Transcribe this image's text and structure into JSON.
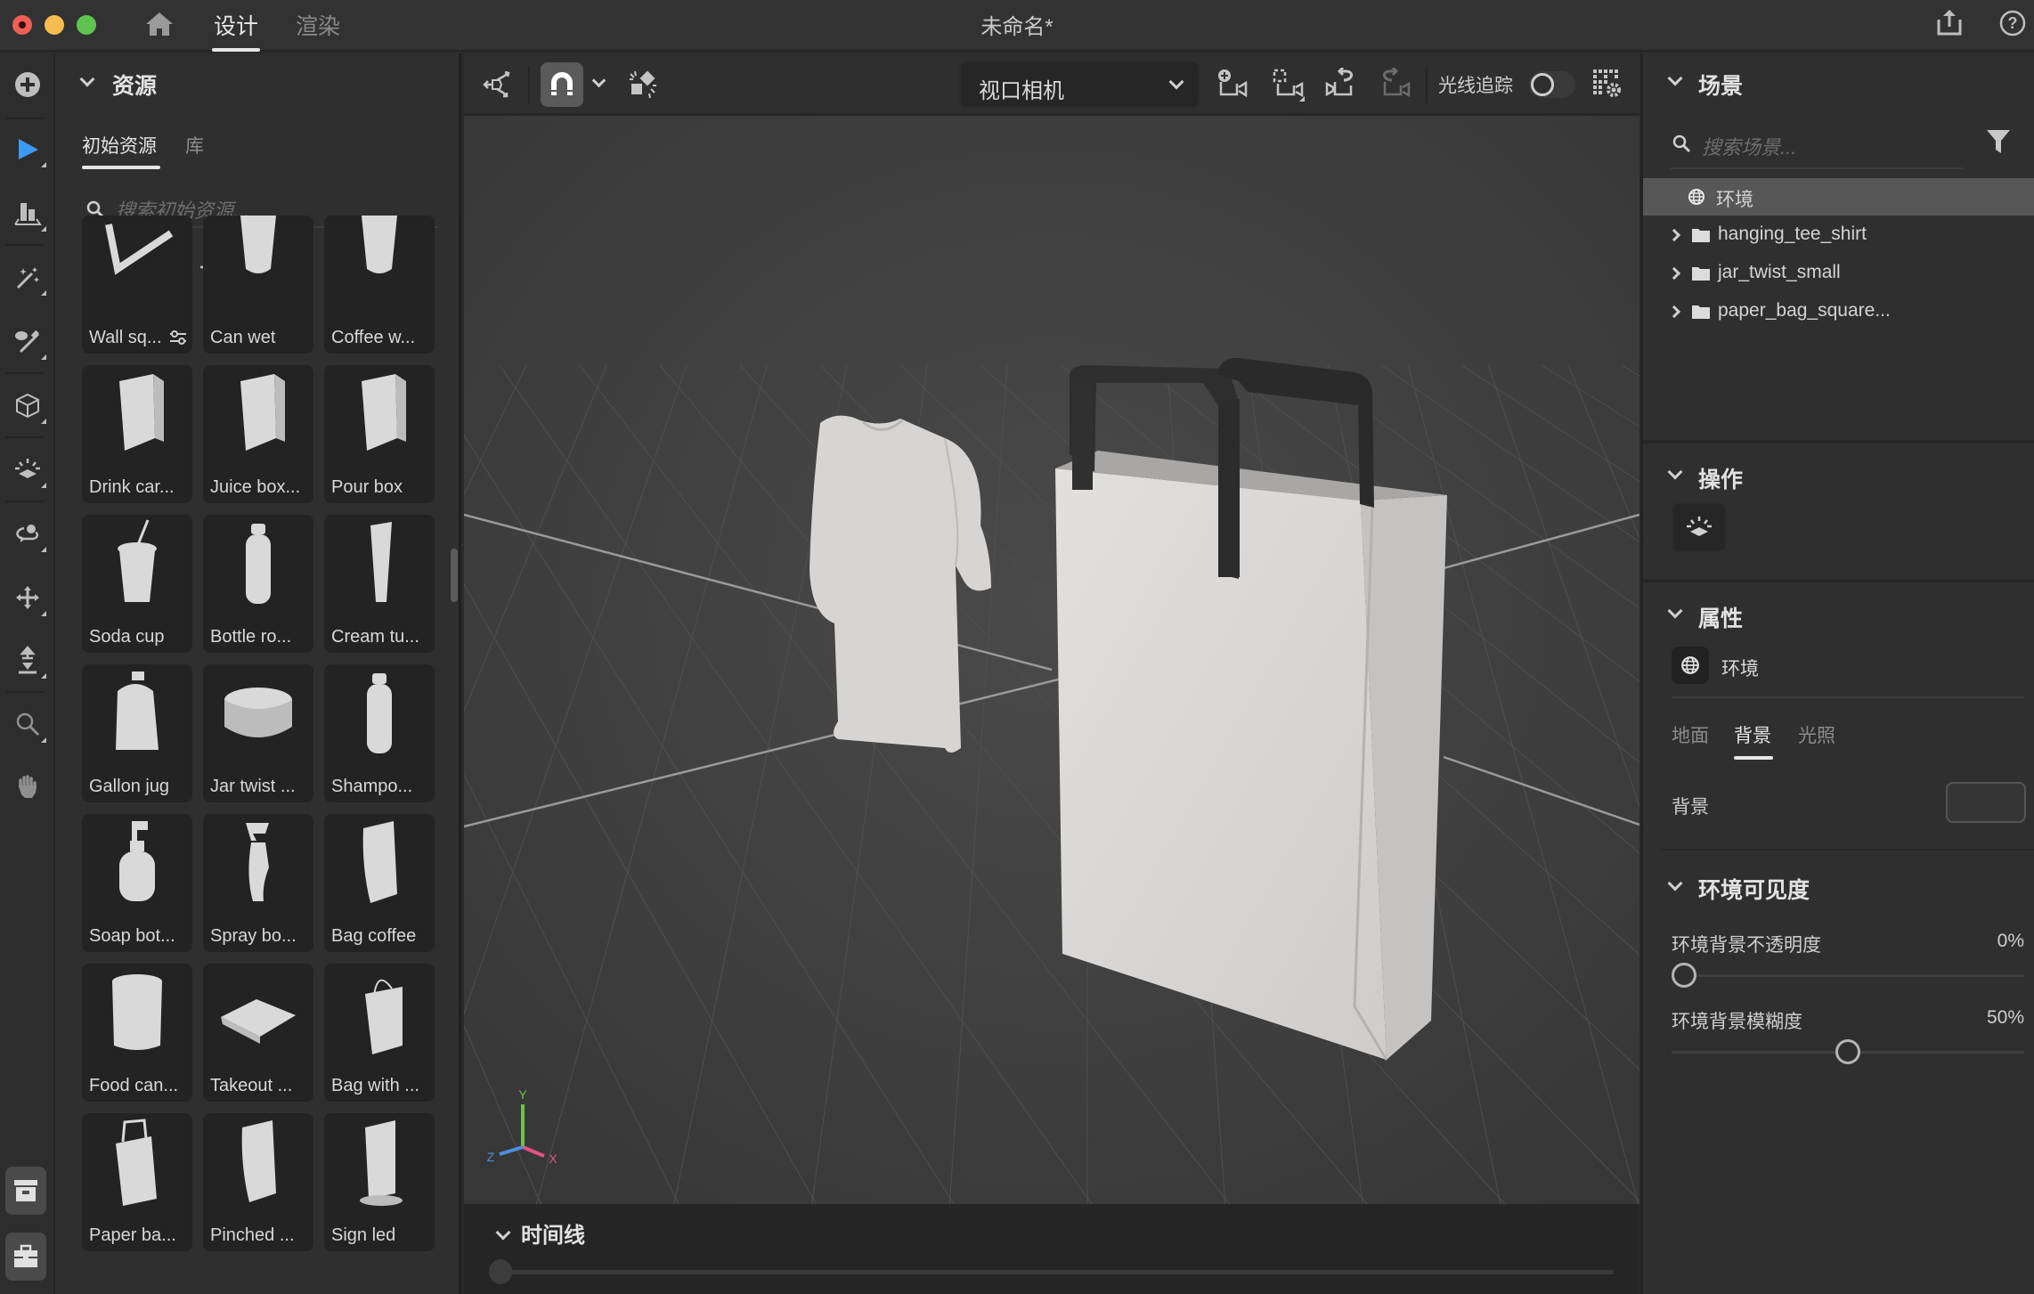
{
  "window": {
    "title": "未命名*",
    "tabs": [
      {
        "label": "设计",
        "active": true
      },
      {
        "label": "渲染",
        "active": false
      }
    ],
    "traffic_lights": {
      "close": "#ee5f57",
      "minimize": "#f5bd4f",
      "maximize": "#5fc351"
    },
    "icons": {
      "home": "home-icon",
      "share": "share-icon",
      "help": "help-icon"
    }
  },
  "left_toolbar": {
    "tools": [
      {
        "name": "add",
        "icon": "plus-circle-icon"
      },
      {
        "name": "select",
        "icon": "select-arrow-icon",
        "active": true,
        "accent": "#3d9bf5"
      },
      {
        "name": "align",
        "icon": "align-icon"
      },
      {
        "name": "magic-wand",
        "icon": "magic-wand-icon"
      },
      {
        "name": "sample",
        "icon": "eyedropper-icon"
      },
      {
        "name": "object",
        "icon": "cube-icon"
      },
      {
        "name": "lighting",
        "icon": "light-icon"
      },
      {
        "name": "orbit",
        "icon": "orbit-icon"
      },
      {
        "name": "pan",
        "icon": "move-icon"
      },
      {
        "name": "dolly",
        "icon": "dolly-icon"
      },
      {
        "name": "zoom",
        "icon": "zoom-icon"
      },
      {
        "name": "hand",
        "icon": "hand-icon"
      }
    ],
    "bottom": [
      {
        "name": "archive",
        "icon": "archive-icon"
      },
      {
        "name": "toolbox",
        "icon": "toolbox-icon"
      }
    ]
  },
  "assets": {
    "title": "资源",
    "tabs": [
      {
        "label": "初始资源",
        "active": true
      },
      {
        "label": "库",
        "active": false
      }
    ],
    "search_placeholder": "搜索初始资源...",
    "filters": [
      "models-icon",
      "materials-icon",
      "lights-icon",
      "images-icon"
    ],
    "view_toggle": "list-view-icon",
    "items": [
      {
        "label": "Wall sq...",
        "has_settings": true
      },
      {
        "label": "Can wet"
      },
      {
        "label": "Coffee w..."
      },
      {
        "label": "Drink car..."
      },
      {
        "label": "Juice box..."
      },
      {
        "label": "Pour box"
      },
      {
        "label": "Soda cup"
      },
      {
        "label": "Bottle ro..."
      },
      {
        "label": "Cream tu..."
      },
      {
        "label": "Gallon jug"
      },
      {
        "label": "Jar twist ..."
      },
      {
        "label": "Shampo..."
      },
      {
        "label": "Soap bot..."
      },
      {
        "label": "Spray bo..."
      },
      {
        "label": "Bag coffee"
      },
      {
        "label": "Food can..."
      },
      {
        "label": "Takeout ..."
      },
      {
        "label": "Bag with ..."
      },
      {
        "label": "Paper ba..."
      },
      {
        "label": "Pinched ..."
      },
      {
        "label": "Sign led"
      }
    ]
  },
  "viewport_toolbar": {
    "camera_select": "视口相机",
    "raytrace_label": "光线追踪",
    "raytrace_on": false,
    "icons": [
      "transform-icon",
      "snap-magnet-icon",
      "snap-options-chevron-icon",
      "drop-to-ground-icon",
      "add-camera-icon",
      "fit-camera-icon",
      "undo-camera-icon",
      "redo-camera-icon",
      "render-settings-icon"
    ]
  },
  "viewport": {
    "axes": {
      "x": "X",
      "y": "Y",
      "z": "Z",
      "x_color": "#e0557f",
      "y_color": "#6cc24a",
      "z_color": "#4e8fdc"
    }
  },
  "timeline": {
    "title": "时间线",
    "position": 0
  },
  "scene": {
    "title": "场景",
    "search_placeholder": "搜索场景...",
    "items": [
      {
        "label": "环境",
        "type": "environment",
        "selected": true
      },
      {
        "label": "hanging_tee_shirt",
        "type": "group"
      },
      {
        "label": "jar_twist_small",
        "type": "group"
      },
      {
        "label": "paper_bag_square...",
        "type": "group"
      }
    ]
  },
  "actions": {
    "title": "操作"
  },
  "properties": {
    "title": "属性",
    "object_label": "环境",
    "tabs": [
      {
        "label": "地面",
        "active": false
      },
      {
        "label": "背景",
        "active": true
      },
      {
        "label": "光照",
        "active": false
      }
    ],
    "background_label": "背景",
    "background_color": "#353535"
  },
  "env_visibility": {
    "title": "环境可见度",
    "opacity_label": "环境背景不透明度",
    "opacity_value": "0%",
    "opacity": 0,
    "blur_label": "环境背景模糊度",
    "blur_value": "50%",
    "blur": 0.5
  }
}
